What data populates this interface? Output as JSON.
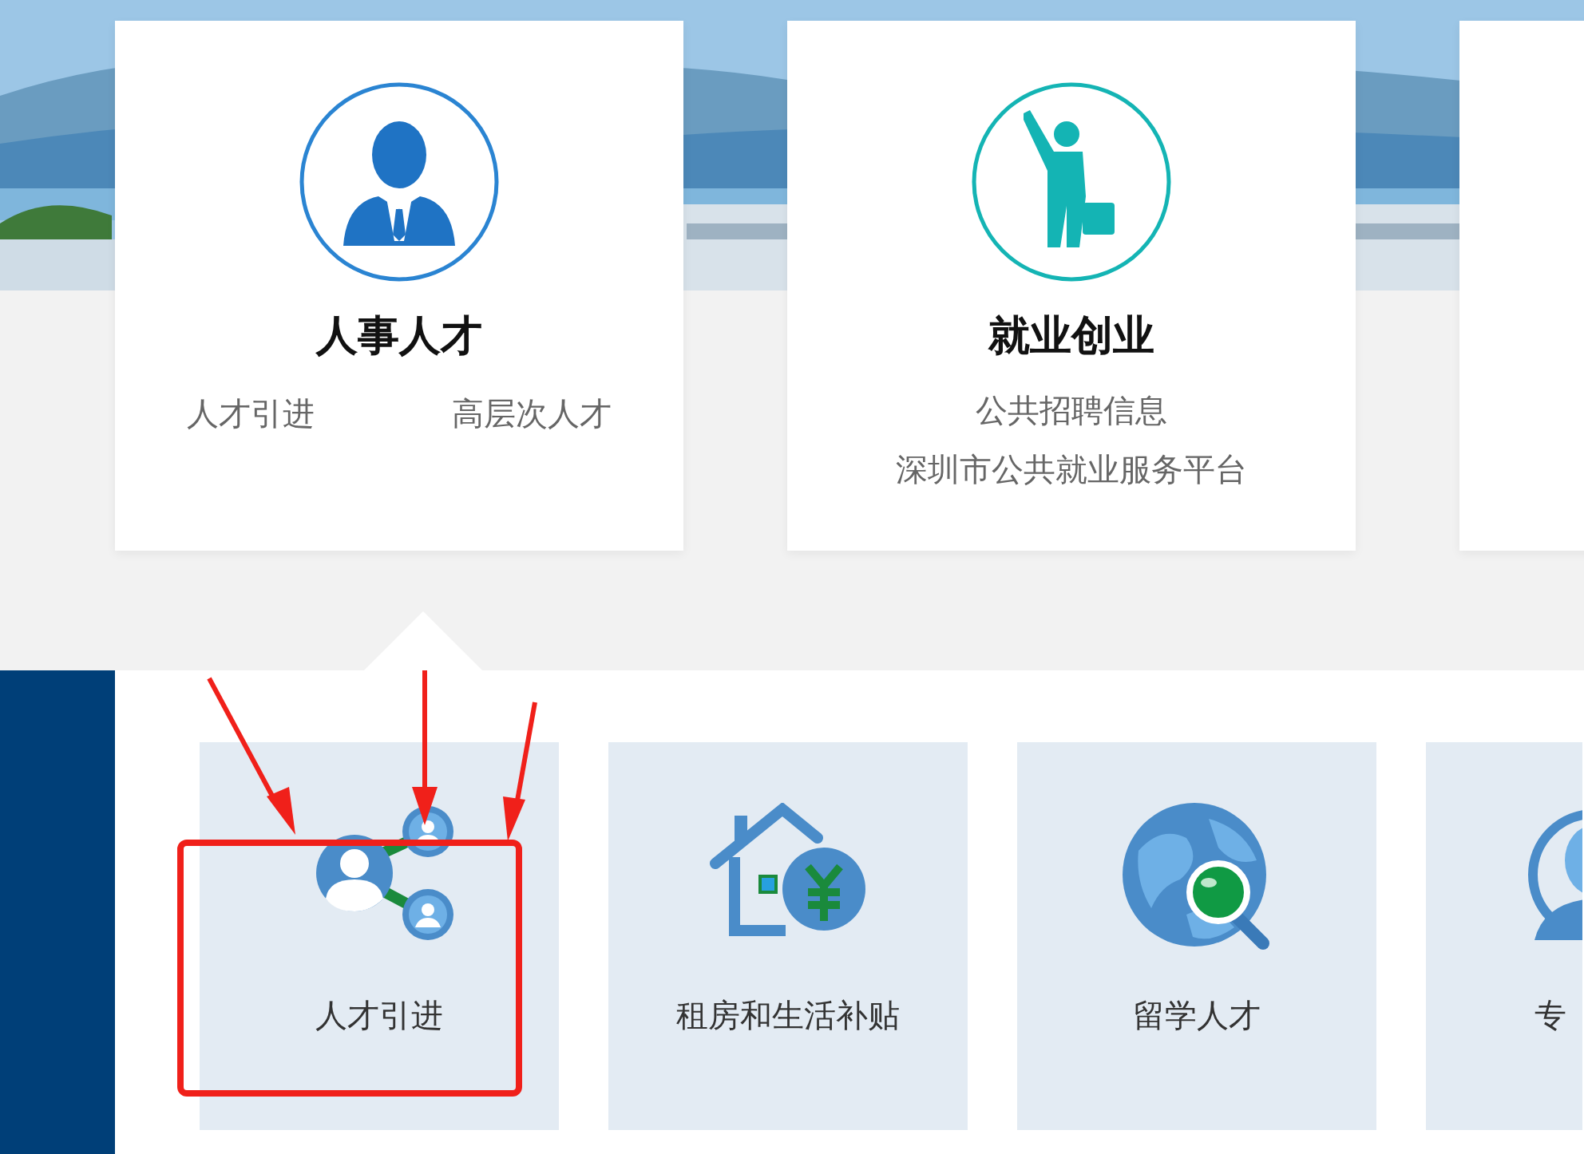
{
  "categories": [
    {
      "kind": "card",
      "title": "人事人才",
      "selected": true,
      "links": [
        "人才引进",
        "高层次人才"
      ]
    },
    {
      "kind": "card",
      "title": "就业创业",
      "selected": false,
      "links": [
        "公共招聘信息",
        "深圳市公共就业服务平台"
      ]
    },
    {
      "kind": "blank",
      "selected": false
    }
  ],
  "services": [
    {
      "kind": "full",
      "label": "人才引进",
      "highlighted": true
    },
    {
      "kind": "full",
      "label": "租房和生活补贴",
      "highlighted": false
    },
    {
      "kind": "full",
      "label": "留学人才",
      "highlighted": false
    },
    {
      "kind": "partial",
      "label": "专",
      "highlighted": false
    }
  ]
}
